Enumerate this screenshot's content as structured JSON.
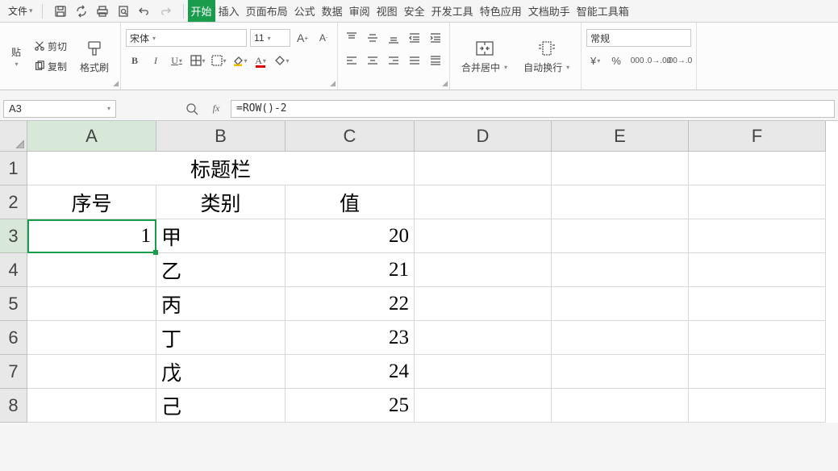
{
  "menubar": {
    "file": "文件",
    "tabs": [
      "开始",
      "插入",
      "页面布局",
      "公式",
      "数据",
      "审阅",
      "视图",
      "安全",
      "开发工具",
      "特色应用",
      "文档助手",
      "智能工具箱"
    ],
    "active_tab_index": 0
  },
  "ribbon": {
    "clipboard": {
      "cut": "剪切",
      "copy": "复制",
      "format_painter": "格式刷",
      "paste": "贴"
    },
    "font": {
      "name": "宋体",
      "size": "11"
    },
    "merge": "合并居中",
    "wrap": "自动换行",
    "number_format": "常规"
  },
  "formulabar": {
    "cell_ref": "A3",
    "fx_label": "fx",
    "formula": "=ROW()-2"
  },
  "sheet": {
    "columns": [
      "A",
      "B",
      "C",
      "D",
      "E",
      "F"
    ],
    "rows_visible": [
      "1",
      "2",
      "3",
      "4",
      "5",
      "6",
      "7",
      "8"
    ],
    "selected_cell": "A3",
    "merged_title": "标题栏",
    "headers": {
      "A2": "序号",
      "B2": "类别",
      "C2": "值"
    },
    "data": [
      {
        "A": "1",
        "B": "甲",
        "C": "20"
      },
      {
        "A": "",
        "B": "乙",
        "C": "21"
      },
      {
        "A": "",
        "B": "丙",
        "C": "22"
      },
      {
        "A": "",
        "B": "丁",
        "C": "23"
      },
      {
        "A": "",
        "B": "戊",
        "C": "24"
      },
      {
        "A": "",
        "B": "己",
        "C": "25"
      }
    ]
  }
}
